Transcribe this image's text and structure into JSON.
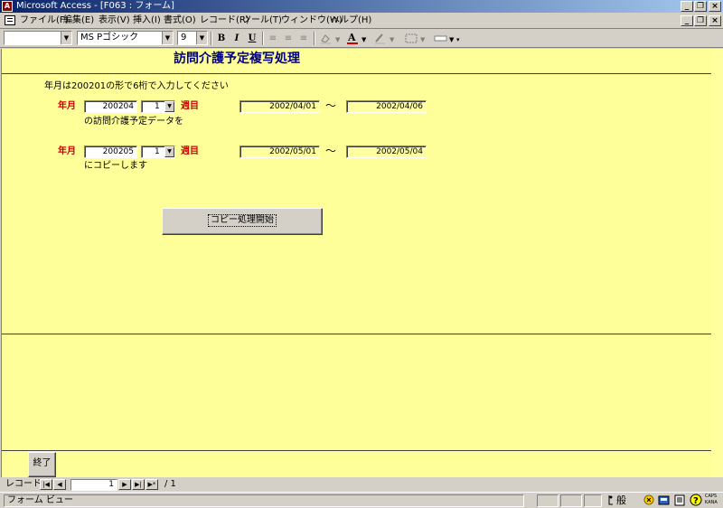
{
  "window": {
    "title": "Microsoft Access - [F063 : フォーム]",
    "app_icon": "A",
    "minimize": "_",
    "restore": "❐",
    "close": "×"
  },
  "menu": {
    "items": [
      "ファイル(F)",
      "編集(E)",
      "表示(V)",
      "挿入(I)",
      "書式(O)",
      "レコード(R)",
      "ツール(T)",
      "ウィンドウ(W)",
      "ヘルプ(H)"
    ]
  },
  "toolbar": {
    "object_combo": "",
    "font_name": "MS Pゴシック",
    "font_size": "9",
    "bold": "B",
    "italic": "I",
    "underline": "U"
  },
  "form": {
    "title": "訪問介護予定複写処理",
    "instruction": "年月は200201の形で6桁で入力してください",
    "source": {
      "year_month_label": "年月",
      "year_month": "200204",
      "week": "1",
      "week_label": "週目",
      "start_date": "2002/04/01",
      "tilde": "～",
      "end_date": "2002/04/06",
      "caption": "の訪問介護予定データを"
    },
    "target": {
      "year_month_label": "年月",
      "year_month": "200205",
      "week": "1",
      "week_label": "週目",
      "start_date": "2002/05/01",
      "tilde": "～",
      "end_date": "2002/05/04",
      "caption": "にコピーします"
    },
    "copy_button": "コピー処理開始",
    "exit_button": "終了"
  },
  "record_nav": {
    "label": "レコード:",
    "current": "1",
    "total": "/ 1"
  },
  "status": {
    "view": "フォーム ビュー",
    "ime_mode": "般",
    "caps": "CAPS",
    "kana": "KANA"
  }
}
